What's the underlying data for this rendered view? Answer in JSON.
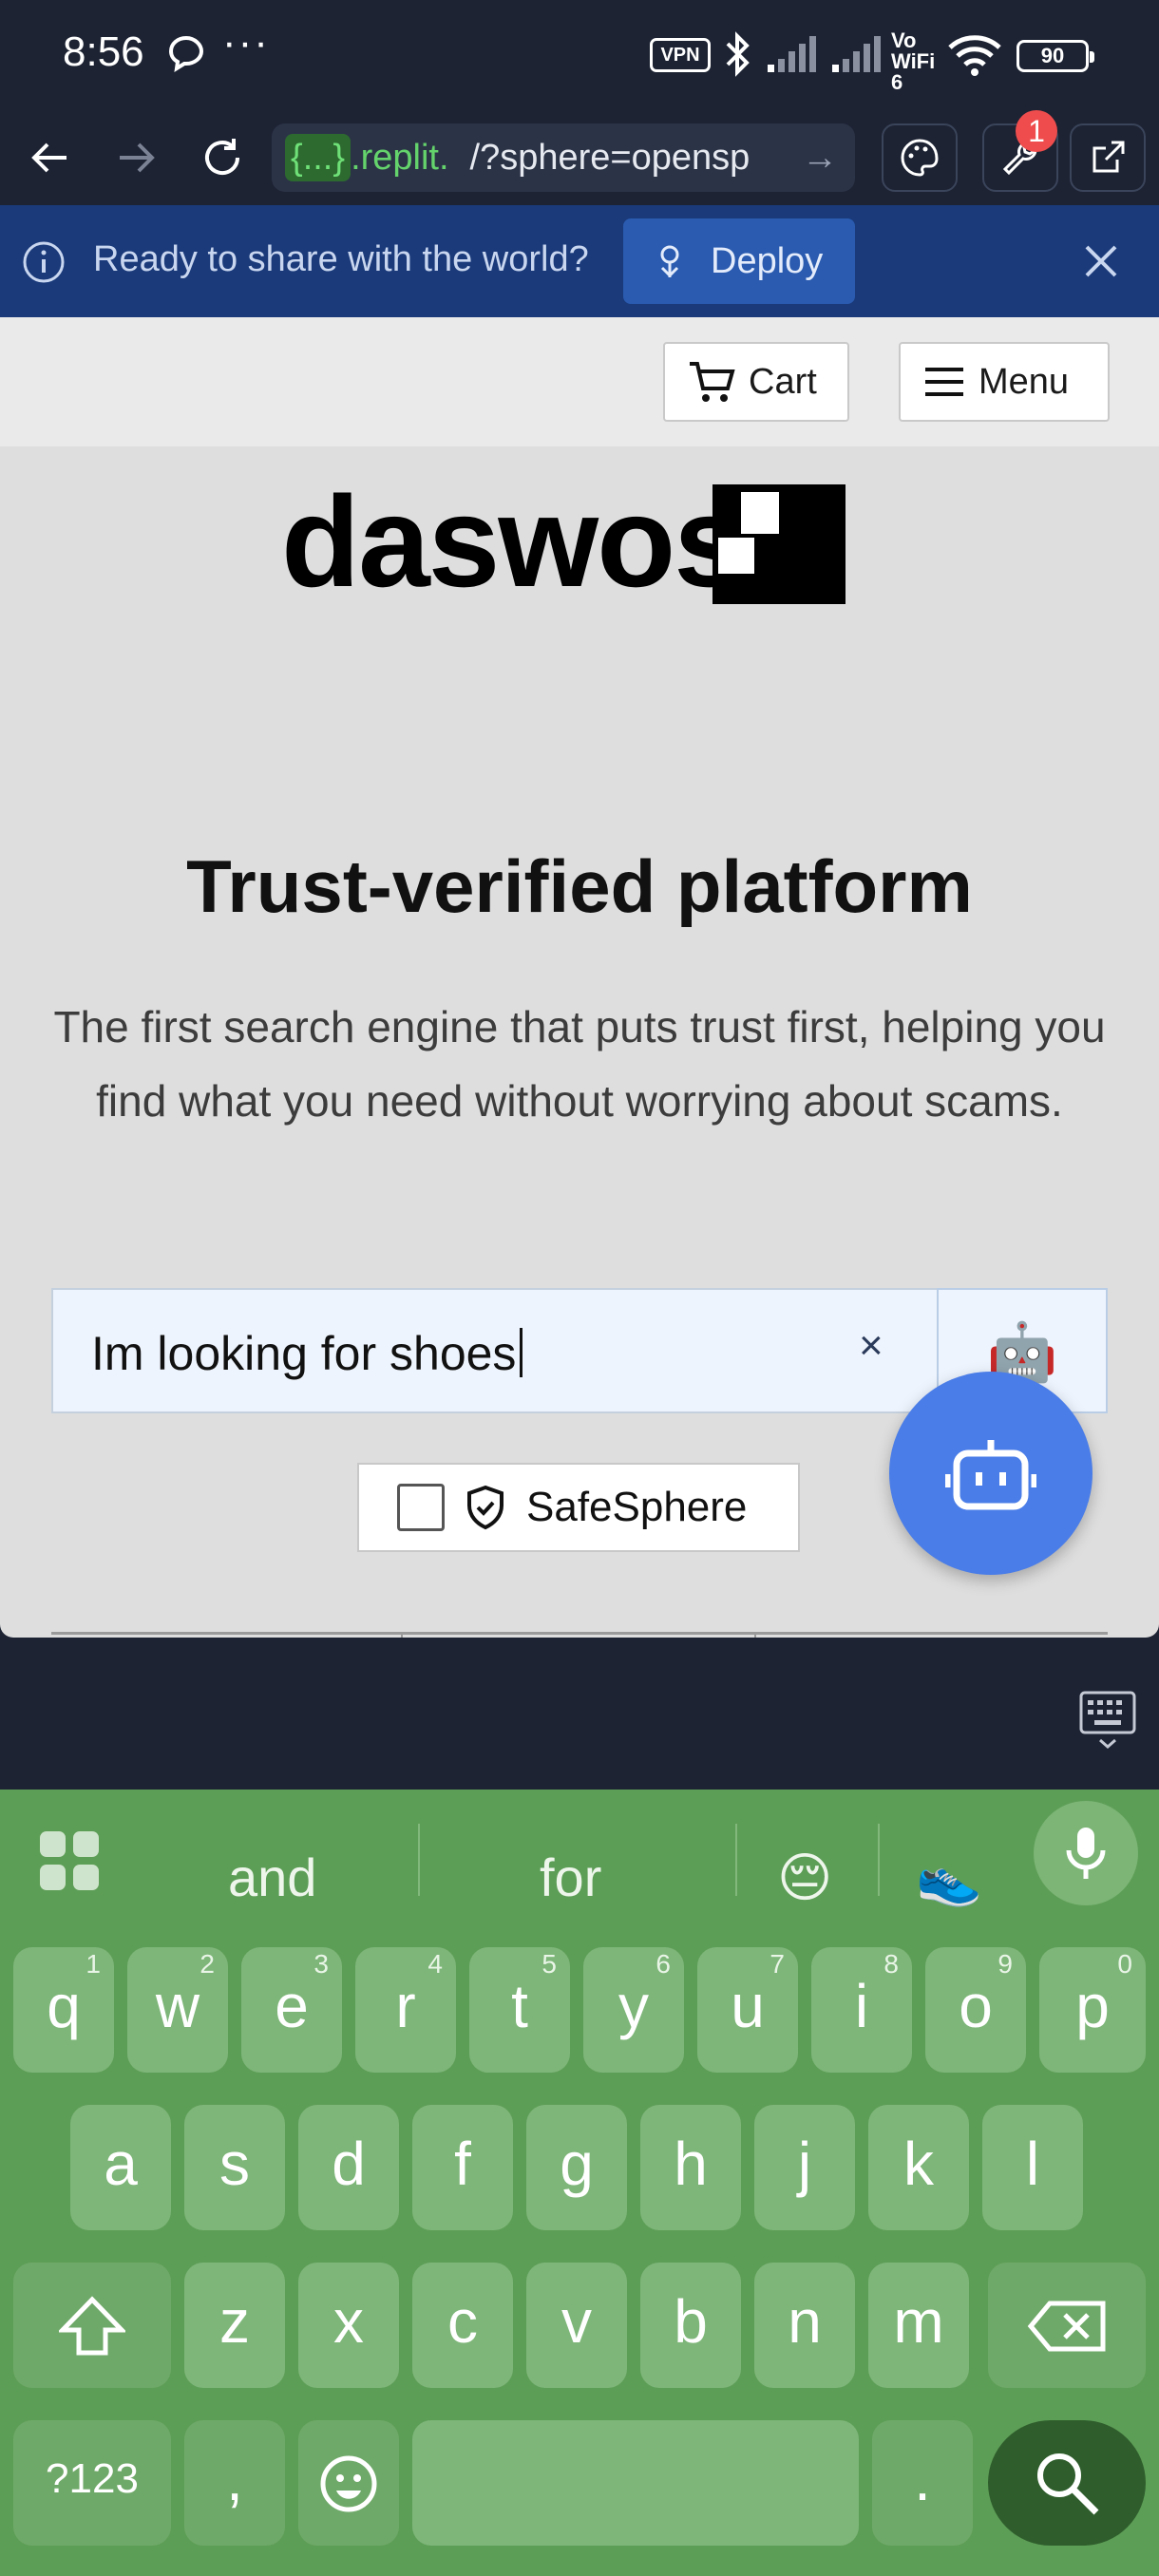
{
  "status_bar": {
    "time": "8:56",
    "dots": "···",
    "vpn": "VPN",
    "volte": "Vo WiFi 6",
    "battery": "90"
  },
  "browser": {
    "url_host_prefix": "{...}",
    "url_host": ".replit.",
    "url_path": "/?sphere=opensp",
    "notification_count": "1"
  },
  "banner": {
    "message": "Ready to share with the world?",
    "deploy_label": "Deploy"
  },
  "header": {
    "cart_label": "Cart",
    "menu_label": "Menu"
  },
  "hero": {
    "logo_text": "daswos",
    "headline": "Trust-verified platform",
    "subtext": "The first search engine that puts trust first, helping you find what you need without worrying about scams."
  },
  "search": {
    "value": "Im looking for shoes",
    "clear": "×",
    "assistant_emoji": "🤖"
  },
  "safesphere": {
    "label": "SafeSphere",
    "checked": false
  },
  "keyboard": {
    "suggestions": [
      "and",
      "for",
      "😔",
      "👟"
    ],
    "row1": [
      {
        "k": "q",
        "n": "1"
      },
      {
        "k": "w",
        "n": "2"
      },
      {
        "k": "e",
        "n": "3"
      },
      {
        "k": "r",
        "n": "4"
      },
      {
        "k": "t",
        "n": "5"
      },
      {
        "k": "y",
        "n": "6"
      },
      {
        "k": "u",
        "n": "7"
      },
      {
        "k": "i",
        "n": "8"
      },
      {
        "k": "o",
        "n": "9"
      },
      {
        "k": "p",
        "n": "0"
      }
    ],
    "row2": [
      "a",
      "s",
      "d",
      "f",
      "g",
      "h",
      "j",
      "k",
      "l"
    ],
    "row3": [
      "z",
      "x",
      "c",
      "v",
      "b",
      "n",
      "m"
    ],
    "symbols_label": "?123",
    "comma": ",",
    "period": "."
  }
}
